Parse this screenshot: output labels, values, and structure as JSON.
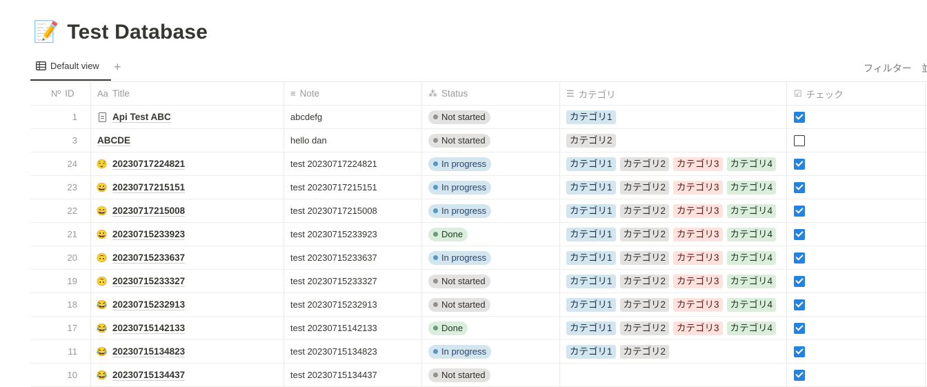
{
  "page": {
    "icon": "📝",
    "title": "Test Database"
  },
  "tabs": {
    "active_label": "Default view",
    "add_label": "+",
    "filter_label": "フィルター",
    "sort_label": "並"
  },
  "columns": {
    "id": {
      "icon": "Nº",
      "label": "ID"
    },
    "title": {
      "icon": "Aa",
      "label": "Title"
    },
    "note": {
      "icon": "≡",
      "label": "Note"
    },
    "status": {
      "icon": "⁂",
      "label": "Status"
    },
    "category": {
      "icon": "☰",
      "label": "カテゴリ"
    },
    "check": {
      "icon": "☑",
      "label": "チェック"
    }
  },
  "status_colors": {
    "Not started": "#e3e2e0",
    "In progress": "#d3e5ef",
    "Done": "#dbeddb"
  },
  "accent_color": "#2383e2",
  "rows": [
    {
      "id": "1",
      "icon": "page-icon",
      "emoji": "",
      "title": "Api Test ABC",
      "note": "abcdefg",
      "status": "Not started",
      "categories": [
        "カテゴリ1"
      ],
      "checked": true
    },
    {
      "id": "3",
      "icon": "",
      "emoji": "",
      "title": "ABCDE",
      "note": "hello dan",
      "status": "Not started",
      "categories": [
        "カテゴリ2"
      ],
      "checked": false
    },
    {
      "id": "24",
      "icon": "emoji",
      "emoji": "😌",
      "title": "20230717224821",
      "note": "test 20230717224821",
      "status": "In progress",
      "categories": [
        "カテゴリ1",
        "カテゴリ2",
        "カテゴリ3",
        "カテゴリ4"
      ],
      "checked": true
    },
    {
      "id": "23",
      "icon": "emoji",
      "emoji": "😀",
      "title": "20230717215151",
      "note": "test 20230717215151",
      "status": "In progress",
      "categories": [
        "カテゴリ1",
        "カテゴリ2",
        "カテゴリ3",
        "カテゴリ4"
      ],
      "checked": true
    },
    {
      "id": "22",
      "icon": "emoji",
      "emoji": "😄",
      "title": "20230717215008",
      "note": "test 20230717215008",
      "status": "In progress",
      "categories": [
        "カテゴリ1",
        "カテゴリ2",
        "カテゴリ3",
        "カテゴリ4"
      ],
      "checked": true
    },
    {
      "id": "21",
      "icon": "emoji",
      "emoji": "😀",
      "title": "20230715233923",
      "note": "test 20230715233923",
      "status": "Done",
      "categories": [
        "カテゴリ1",
        "カテゴリ2",
        "カテゴリ3",
        "カテゴリ4"
      ],
      "checked": true
    },
    {
      "id": "20",
      "icon": "emoji",
      "emoji": "🙃",
      "title": "20230715233637",
      "note": "test 20230715233637",
      "status": "In progress",
      "categories": [
        "カテゴリ1",
        "カテゴリ2",
        "カテゴリ3",
        "カテゴリ4"
      ],
      "checked": true
    },
    {
      "id": "19",
      "icon": "emoji",
      "emoji": "🙃",
      "title": "20230715233327",
      "note": "test 20230715233327",
      "status": "Not started",
      "categories": [
        "カテゴリ1",
        "カテゴリ2",
        "カテゴリ3",
        "カテゴリ4"
      ],
      "checked": true
    },
    {
      "id": "18",
      "icon": "emoji",
      "emoji": "😂",
      "title": "20230715232913",
      "note": "test 20230715232913",
      "status": "Not started",
      "categories": [
        "カテゴリ1",
        "カテゴリ2",
        "カテゴリ3",
        "カテゴリ4"
      ],
      "checked": true
    },
    {
      "id": "17",
      "icon": "emoji",
      "emoji": "😂",
      "title": "20230715142133",
      "note": "test 20230715142133",
      "status": "Done",
      "categories": [
        "カテゴリ1",
        "カテゴリ2",
        "カテゴリ3",
        "カテゴリ4"
      ],
      "checked": true
    },
    {
      "id": "11",
      "icon": "emoji",
      "emoji": "😂",
      "title": "20230715134823",
      "note": "test 20230715134823",
      "status": "In progress",
      "categories": [
        "カテゴリ1",
        "カテゴリ2"
      ],
      "checked": true
    },
    {
      "id": "10",
      "icon": "emoji",
      "emoji": "😂",
      "title": "20230715134437",
      "note": "test 20230715134437",
      "status": "Not started",
      "categories": [],
      "checked": true
    }
  ]
}
